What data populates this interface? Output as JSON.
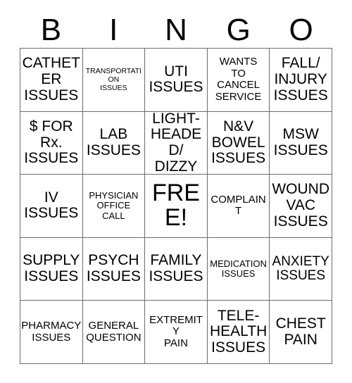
{
  "card": {
    "title": "BINGO",
    "header_letters": [
      "B",
      "I",
      "N",
      "G",
      "O"
    ],
    "free_space_label": "FREE!",
    "border_color": "#6b6b6b",
    "text_color": "#000000",
    "background_color": "#ffffff",
    "rows": 5,
    "columns": 5
  },
  "cells": [
    {
      "text": "CATHETER\nISSUES",
      "size": "fs-lg"
    },
    {
      "text": "TRANSPORTATION\nISSUES",
      "size": "fs-xxs"
    },
    {
      "text": "UTI\nISSUES",
      "size": "fs-lg"
    },
    {
      "text": "WANTS\nTO\nCANCEL\nSERVICE",
      "size": "fs-sm"
    },
    {
      "text": "FALL/\nINJURY\nISSUES",
      "size": "fs-lg"
    },
    {
      "text": "$ FOR\nRx.\nISSUES",
      "size": "fs-lg"
    },
    {
      "text": "LAB\nISSUES",
      "size": "fs-lg"
    },
    {
      "text": "LIGHT-\nHEADED/\nDIZZY",
      "size": "fs-lg"
    },
    {
      "text": "N&V\nBOWEL\nISSUES",
      "size": "fs-lg"
    },
    {
      "text": "MSW\nISSUES",
      "size": "fs-lg"
    },
    {
      "text": "IV\nISSUES",
      "size": "fs-lg"
    },
    {
      "text": "PHYSICIAN\nOFFICE\nCALL",
      "size": "fs-xs"
    },
    {
      "text": "FREE!",
      "size": "fs-xl"
    },
    {
      "text": "COMPLAINT",
      "size": "fs-sm"
    },
    {
      "text": "WOUND\nVAC\nISSUES",
      "size": "fs-lg"
    },
    {
      "text": "SUPPLY\nISSUES",
      "size": "fs-lg"
    },
    {
      "text": "PSYCH\nISSUES",
      "size": "fs-lg"
    },
    {
      "text": "FAMILY\nISSUES",
      "size": "fs-lg"
    },
    {
      "text": "MEDICATION\nISSUES",
      "size": "fs-xs"
    },
    {
      "text": "ANXIETY\nISSUES",
      "size": "fs-md"
    },
    {
      "text": "PHARMACY\nISSUES",
      "size": "fs-sm"
    },
    {
      "text": "GENERAL\nQUESTION",
      "size": "fs-sm"
    },
    {
      "text": "EXTREMITY\nPAIN",
      "size": "fs-sm"
    },
    {
      "text": "TELE-\nHEALTH\nISSUES",
      "size": "fs-lg"
    },
    {
      "text": "CHEST\nPAIN",
      "size": "fs-lg"
    }
  ]
}
